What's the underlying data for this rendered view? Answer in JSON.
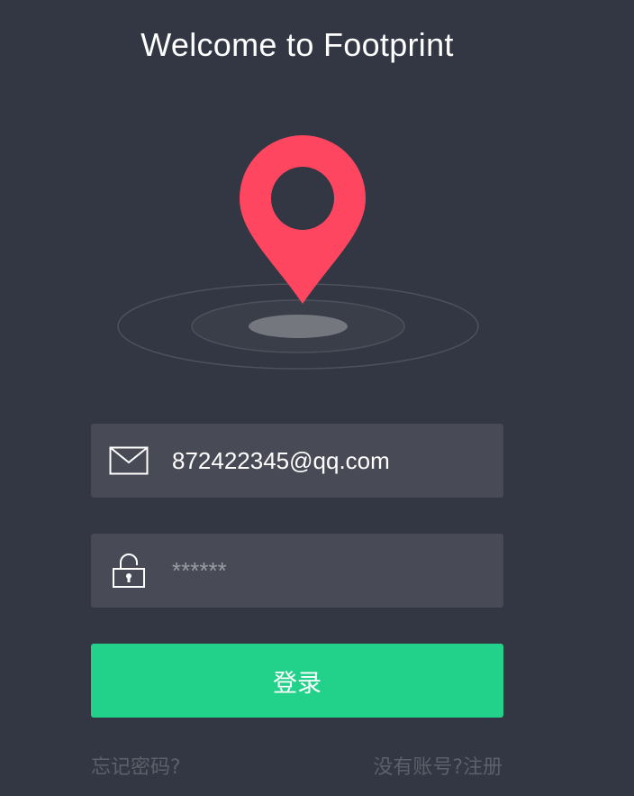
{
  "header": {
    "title": "Welcome to Footprint"
  },
  "illustration": {
    "pin_color": "#ff4660",
    "icon": "location-pin-icon"
  },
  "form": {
    "email": {
      "value": "872422345@qq.com",
      "icon": "mail-icon"
    },
    "password": {
      "placeholder": "******",
      "icon": "lock-icon"
    },
    "login_label": "登录",
    "accent_color": "#22d28a"
  },
  "links": {
    "forgot_password": "忘记密码?",
    "register": "没有账号?注册"
  }
}
